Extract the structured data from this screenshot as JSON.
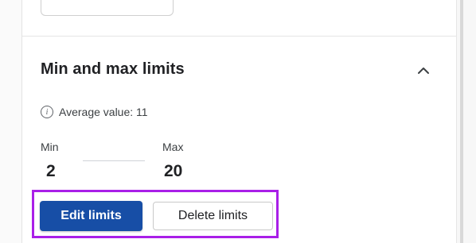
{
  "section": {
    "title": "Min and max limits",
    "toggle_icon": "chevron-up-icon"
  },
  "info": {
    "icon": "info-icon",
    "icon_glyph": "i",
    "text": "Average value: 11"
  },
  "limits": {
    "min_label": "Min",
    "min_value": "2",
    "max_label": "Max",
    "max_value": "20"
  },
  "actions": {
    "edit_label": "Edit limits",
    "delete_label": "Delete limits"
  },
  "colors": {
    "primary": "#174ea6",
    "highlight": "#a91fe8"
  }
}
